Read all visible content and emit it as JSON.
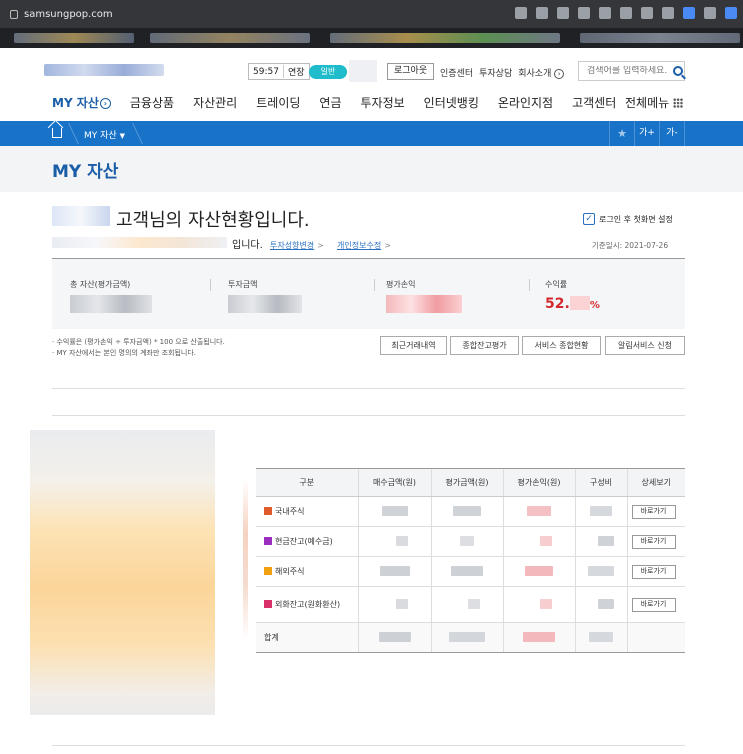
{
  "browser": {
    "url": "samsungpop.com"
  },
  "header": {
    "timer": "59:57",
    "extend_label": "연장",
    "mode_label": "일반",
    "logout_label": "로그아웃",
    "util_links": [
      "인증센터",
      "투자상담",
      "회사소개"
    ],
    "search_placeholder": "검색어를 입력하세요."
  },
  "gnb": {
    "items": [
      "MY 자산",
      "금융상품",
      "자산관리",
      "트레이딩",
      "연금",
      "투자정보",
      "인터넷뱅킹",
      "온라인지점",
      "고객센터"
    ],
    "full_menu_label": "전체메뉴"
  },
  "location": {
    "crumb": "MY 자산",
    "font_plus": "가+",
    "font_minus": "가-"
  },
  "page": {
    "title": "MY 자산",
    "greeting": "고객님의 자산현황입니다.",
    "sub_suffix": "입니다.",
    "link_invest_profile": "투자성향변경",
    "link_personal_info": "개인정보수정",
    "login_default_label": "로그인 후 첫화면 설정",
    "base_date": "기준일시: 2021-07-26"
  },
  "summary": {
    "total_label": "총 자산(평가금액)",
    "invest_label": "투자금액",
    "pnl_label": "평가손익",
    "rate_label": "수익률",
    "rate_prefix": "52.",
    "rate_suffix": "%"
  },
  "notes": [
    "· 수익률은 (평가손익 ÷ 투자금액) * 100 으로 산출됩니다.",
    "· MY 자산에서는 본인 명의의 계좌만 조회됩니다."
  ],
  "actions": [
    "최근거래내역",
    "종합잔고평가",
    "서비스 종합현황",
    "알림서비스 신청"
  ],
  "table": {
    "headers": [
      "구분",
      "매수금액(원)",
      "평가금액(원)",
      "평가손익(원)",
      "구성비",
      "상세보기"
    ],
    "rows": [
      {
        "name": "국내주식",
        "color": "#e05a2b"
      },
      {
        "name": "현금잔고(예수금)",
        "color": "#9a2fbf"
      },
      {
        "name": "해외주식",
        "color": "#f1a10f"
      },
      {
        "name": "외화잔고(원화환산)",
        "color": "#d9306a"
      }
    ],
    "total_label": "합계",
    "detail_button": "바로가기"
  }
}
